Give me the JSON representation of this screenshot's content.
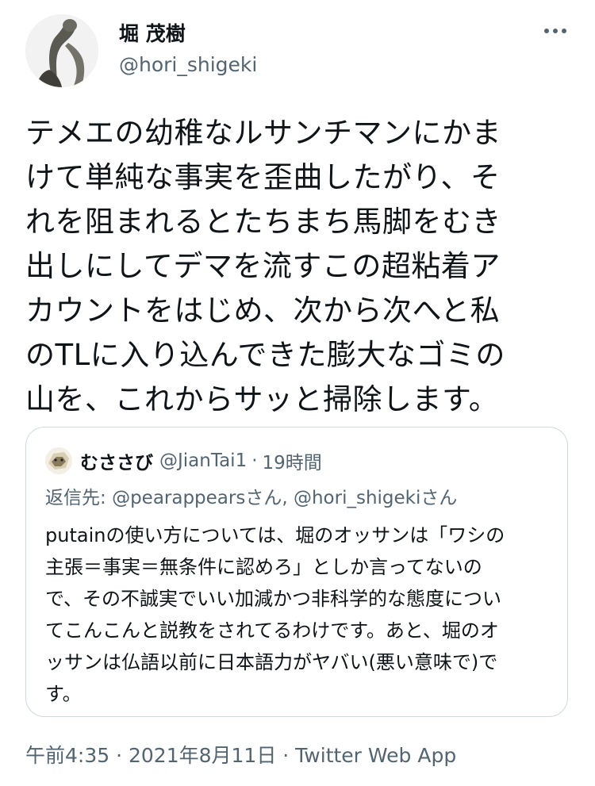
{
  "author": {
    "display_name": "堀 茂樹",
    "handle": "@hori_shigeki"
  },
  "tweet": {
    "text": "テメエの幼稚なルサンチマンにかま\nけて単純な事実を歪曲したがり、そ\nれを阻まれるとたちまち馬脚をむき\n出しにしてデマを流すこの超粘着ア\nカウントをはじめ、次から次へと私\nのTLに入り込んできた膨大なゴミの\n山を、これからサッと掃除します。"
  },
  "quoted": {
    "display_name": "むささび",
    "handle": "@JianTai1",
    "separator": "·",
    "time": "19時間",
    "reply_prefix": "返信先: ",
    "reply_mention_1": "@pearappears",
    "reply_san_1": "さん",
    "reply_comma": ", ",
    "reply_mention_2": "@hori_shigeki",
    "reply_san_2": "さん",
    "text": "putainの使い方については、堀のオッサンは「ワシの\n主張＝事実＝無条件に認めろ」としか言ってないの\nで、その不誠実でいい加減かつ非科学的な態度につい\nてこんこんと説教をされてるわけです。あと、堀のオ\nッサンは仏語以前に日本語力がヤバい(悪い意味で)で\nす。"
  },
  "meta": {
    "time": "午前4:35",
    "sep1": " · ",
    "date": "2021年8月11日",
    "sep2": " · ",
    "source": "Twitter Web App"
  },
  "icons": {
    "more": "more-horizontal-icon"
  },
  "colors": {
    "text": "#0f1419",
    "secondary": "#536471",
    "border": "#cfd9de"
  }
}
